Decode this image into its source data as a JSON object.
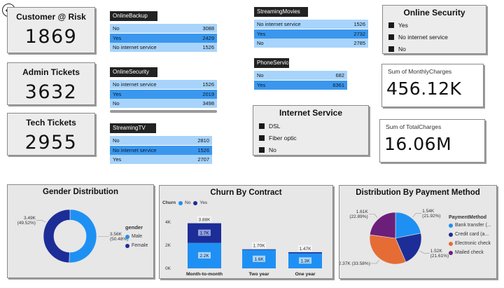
{
  "kpis": {
    "customer_risk": {
      "title": "Customer @ Risk",
      "value": "1869"
    },
    "admin_tickets": {
      "title": "Admin Tickets",
      "value": "3632"
    },
    "tech_tickets": {
      "title": "Tech Tickets",
      "value": "2955"
    }
  },
  "tables": {
    "online_backup": {
      "title": "OnlineBackup",
      "rows": [
        {
          "label": "No",
          "value": "3088"
        },
        {
          "label": "Yes",
          "value": "2429"
        },
        {
          "label": "No internet service",
          "value": "1526"
        }
      ]
    },
    "online_security": {
      "title": "OnlineSecurity",
      "rows": [
        {
          "label": "No internet service",
          "value": "1526"
        },
        {
          "label": "Yes",
          "value": "2019"
        },
        {
          "label": "No",
          "value": "3498"
        }
      ]
    },
    "streaming_tv": {
      "title": "StreamingTV",
      "rows": [
        {
          "label": "No",
          "value": "2810"
        },
        {
          "label": "No internet service",
          "value": "1526"
        },
        {
          "label": "Yes",
          "value": "2707"
        }
      ]
    },
    "streaming_movies": {
      "title": "StreamingMovies",
      "rows": [
        {
          "label": "No internet service",
          "value": "1526"
        },
        {
          "label": "Yes",
          "value": "2732"
        },
        {
          "label": "No",
          "value": "2785"
        }
      ]
    },
    "phone_service": {
      "title": "PhoneService",
      "rows": [
        {
          "label": "No",
          "value": "682"
        },
        {
          "label": "Yes",
          "value": "6361"
        }
      ]
    }
  },
  "slicers": {
    "internet_service": {
      "title": "Internet Service",
      "items": [
        "DSL",
        "Fiber optic",
        "No"
      ]
    },
    "online_security": {
      "title": "Online Security",
      "items": [
        "Yes",
        "No internet service",
        "No"
      ]
    }
  },
  "cards": {
    "monthly": {
      "label": "Sum of MonthlyCharges",
      "value": "456.12K"
    },
    "total": {
      "label": "Sum of TotalCharges",
      "value": "16.06M"
    }
  },
  "colors": {
    "dark_blue": "#1c2d98",
    "light_blue": "#1f90f3",
    "orange": "#e56c35",
    "purple": "#6b1f7a"
  },
  "chart_data": [
    {
      "type": "pie",
      "title": "Gender Distribution",
      "legend_title": "gender",
      "categories": [
        "Male",
        "Female"
      ],
      "values": [
        3.56,
        3.49
      ],
      "labels": [
        "3.56K (50.48%)",
        "3.49K (49.52%)"
      ],
      "label_lines": [
        [
          "3.56K",
          "(50.48%)"
        ],
        [
          "3.49K",
          "(49.52%)"
        ]
      ],
      "colors": [
        "#1f90f3",
        "#1c2d98"
      ]
    },
    {
      "type": "bar",
      "title": "Churn By Contract",
      "legend_title": "Churn",
      "series_names": [
        "No",
        "Yes"
      ],
      "categories": [
        "Month-to-month",
        "Two year",
        "One year"
      ],
      "series": [
        {
          "name": "No",
          "values": [
            2.2,
            1.6,
            1.3
          ]
        },
        {
          "name": "Yes",
          "values": [
            1.7,
            0.05,
            0.1
          ]
        }
      ],
      "totals": [
        "3.88K",
        "1.70K",
        "1.47K"
      ],
      "no_labels": [
        "2.2K",
        "1.6K",
        "1.3K"
      ],
      "yes_labels": [
        "1.7K",
        "",
        ""
      ],
      "y_ticks": [
        "0K",
        "2K",
        "4K"
      ],
      "ylim": [
        0,
        4.6
      ],
      "colors": [
        "#1f90f3",
        "#1c2d98"
      ]
    },
    {
      "type": "pie",
      "title": "Distribution By Payment Method",
      "legend_title": "PaymentMethod",
      "categories": [
        "Bank transfer (...",
        "Credit card (a...",
        "Electronic check",
        "Mailed check"
      ],
      "values": [
        1.54,
        1.52,
        2.37,
        1.61
      ],
      "labels": [
        "1.54K (21.92%)",
        "1.52K (21.61%)",
        "2.37K (33.58%)",
        "1.61K (22.89%)"
      ],
      "label_lines": [
        [
          "1.54K",
          "(21.92%)"
        ],
        [
          "1.52K",
          "(21.61%)"
        ],
        [
          "2.37K (33.58%)"
        ],
        [
          "1.61K",
          "(22.89%)"
        ]
      ],
      "colors": [
        "#1f90f3",
        "#1c2d98",
        "#e56c35",
        "#6b1f7a"
      ]
    }
  ]
}
